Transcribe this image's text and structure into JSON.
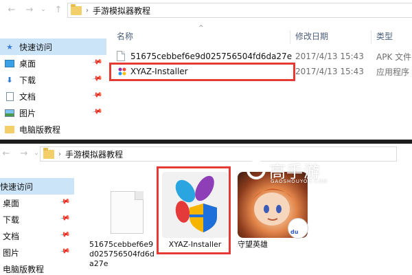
{
  "top": {
    "nav": {
      "back": "←",
      "forward": "→",
      "recent": "⌄",
      "up": "↑"
    },
    "address": {
      "separator": "›",
      "path": "手游模拟器教程"
    },
    "sidebar": [
      {
        "label": "快速访问",
        "icon": "star-icon",
        "active": true,
        "pinned": false
      },
      {
        "label": "桌面",
        "icon": "desktop-icon",
        "active": false,
        "pinned": true
      },
      {
        "label": "下载",
        "icon": "download-icon",
        "active": false,
        "pinned": true
      },
      {
        "label": "文档",
        "icon": "documents-icon",
        "active": false,
        "pinned": true
      },
      {
        "label": "图片",
        "icon": "pictures-icon",
        "active": false,
        "pinned": true
      },
      {
        "label": "电脑版教程",
        "icon": "folder-icon",
        "active": false,
        "pinned": false
      }
    ],
    "columns": {
      "name": "名称",
      "date": "修改日期",
      "type": "类型",
      "sort": "^"
    },
    "files": [
      {
        "name": "51675cebbef6e9d025756504fd6da27e",
        "date": "2017/4/13 15:43",
        "type": "APK 文件",
        "icon": "file-icon"
      },
      {
        "name": "XYAZ-Installer",
        "date": "2017/4/13 15:43",
        "type": "应用程序",
        "icon": "app-icon"
      }
    ]
  },
  "bottom": {
    "nav": {
      "back": "←",
      "forward": "→",
      "recent": "⌄",
      "up": "↑"
    },
    "address": {
      "separator": "›",
      "path": "手游模拟器教程"
    },
    "sidebar": [
      {
        "label": "快速访问",
        "active": true,
        "pinned": false
      },
      {
        "label": "桌面",
        "active": false,
        "pinned": true
      },
      {
        "label": "下载",
        "active": false,
        "pinned": true
      },
      {
        "label": "文档",
        "active": false,
        "pinned": true
      },
      {
        "label": "图片",
        "active": false,
        "pinned": true
      },
      {
        "label": "电脑版教程",
        "active": false,
        "pinned": false
      }
    ],
    "tiles": [
      {
        "label": "51675cebbef6e9d025756504fd6da27e",
        "icon": "file-icon"
      },
      {
        "label": "XYAZ-Installer",
        "icon": "app-icon"
      },
      {
        "label": "守望英雄",
        "icon": "game-icon"
      }
    ],
    "watermark": {
      "title": "高手游",
      "subtitle": "GAOSHOUYOU.COM"
    },
    "badge": "du"
  },
  "colors": {
    "highlight": "#e53935",
    "active": "#cce4f7",
    "divider": "#1e1e1e"
  }
}
